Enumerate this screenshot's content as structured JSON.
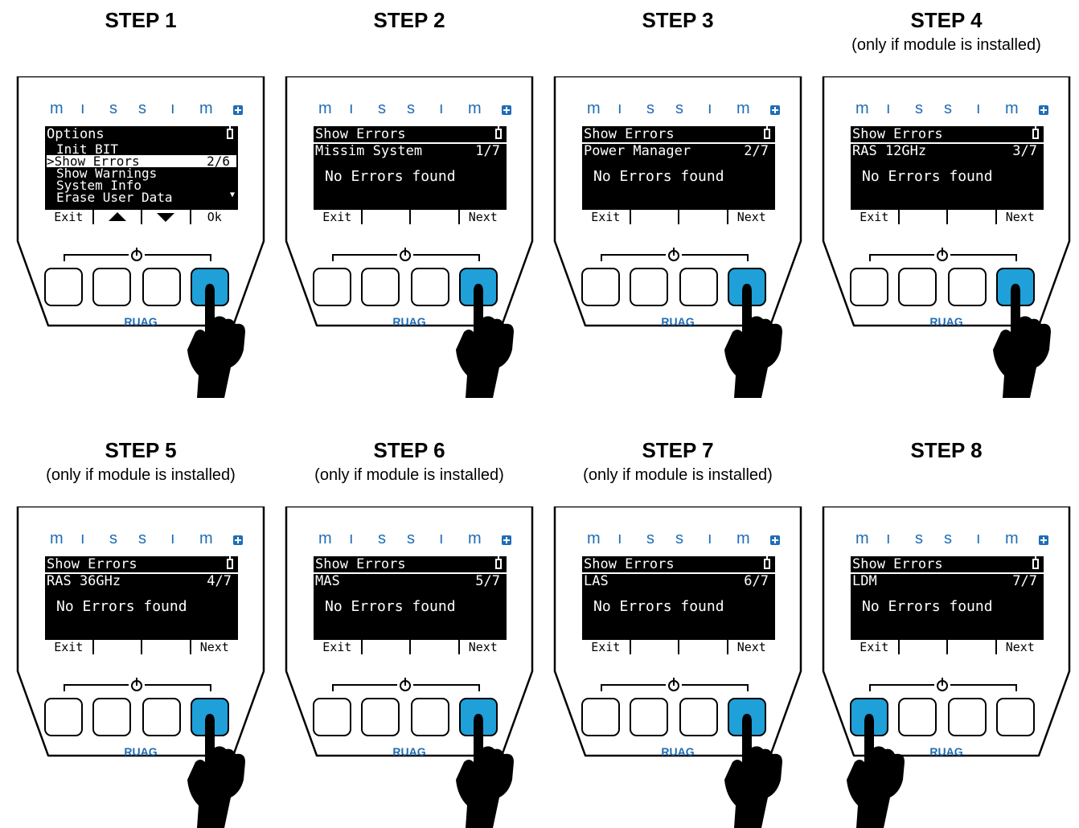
{
  "brand": {
    "letters": [
      "m",
      "ı",
      "s",
      "s",
      "ı",
      "m"
    ],
    "footer_logo": "RUAG",
    "accent_color": "#1f6db5",
    "pressed_button_color": "#1fa0d8"
  },
  "steps": [
    {
      "title": "STEP 1",
      "subtitle": "",
      "screen": {
        "type": "menu",
        "title": "Options",
        "items": [
          "Init BIT",
          ">Show Errors",
          "Show Warnings",
          "System Info",
          "Erase User Data"
        ],
        "selected_index": 1,
        "selected_counter": "2/6",
        "softkeys": [
          "Exit",
          "up-arrow-icon",
          "down-arrow-icon",
          "Ok"
        ]
      },
      "pressed_button": 4
    },
    {
      "title": "STEP 2",
      "subtitle": "",
      "screen": {
        "type": "errors",
        "title": "Show Errors",
        "module": "Missim System",
        "counter": "1/7",
        "message": "No Errors found",
        "softkeys": [
          "Exit",
          "",
          "",
          "Next"
        ]
      },
      "pressed_button": 4
    },
    {
      "title": "STEP 3",
      "subtitle": "",
      "screen": {
        "type": "errors",
        "title": "Show Errors",
        "module": "Power Manager",
        "counter": "2/7",
        "message": "No Errors found",
        "softkeys": [
          "Exit",
          "",
          "",
          "Next"
        ]
      },
      "pressed_button": 4
    },
    {
      "title": "STEP 4",
      "subtitle": "(only if module is installed)",
      "screen": {
        "type": "errors",
        "title": "Show Errors",
        "module": "RAS 12GHz",
        "counter": "3/7",
        "message": "No Errors found",
        "softkeys": [
          "Exit",
          "",
          "",
          "Next"
        ]
      },
      "pressed_button": 4
    },
    {
      "title": "STEP 5",
      "subtitle": "(only if module is installed)",
      "screen": {
        "type": "errors",
        "title": "Show Errors",
        "module": "RAS 36GHz",
        "counter": "4/7",
        "message": "No Errors found",
        "softkeys": [
          "Exit",
          "",
          "",
          "Next"
        ]
      },
      "pressed_button": 4
    },
    {
      "title": "STEP 6",
      "subtitle": "(only if module is installed)",
      "screen": {
        "type": "errors",
        "title": "Show Errors",
        "module": "MAS",
        "counter": "5/7",
        "message": "No Errors found",
        "softkeys": [
          "Exit",
          "",
          "",
          "Next"
        ]
      },
      "pressed_button": 4
    },
    {
      "title": "STEP 7",
      "subtitle": "(only if module is installed)",
      "screen": {
        "type": "errors",
        "title": "Show Errors",
        "module": "LAS",
        "counter": "6/7",
        "message": "No Errors found",
        "softkeys": [
          "Exit",
          "",
          "",
          "Next"
        ]
      },
      "pressed_button": 4
    },
    {
      "title": "STEP 8",
      "subtitle": "",
      "screen": {
        "type": "errors",
        "title": "Show Errors",
        "module": "LDM",
        "counter": "7/7",
        "message": "No Errors found",
        "softkeys": [
          "Exit",
          "",
          "",
          "Next"
        ]
      },
      "pressed_button": 1
    }
  ]
}
